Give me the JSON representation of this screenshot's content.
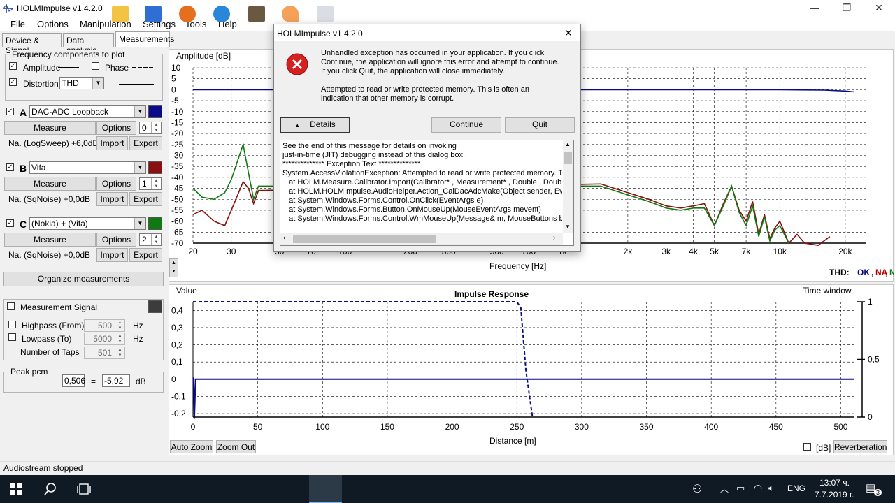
{
  "window": {
    "title": "HOLMImpulse  v1.4.2.0",
    "minimize": "—",
    "restore": "❐",
    "close": "✕"
  },
  "menu": [
    "File",
    "Options",
    "Manipulation",
    "Settings",
    "Tools",
    "Help"
  ],
  "tabs": [
    {
      "label": "Device & Signal",
      "active": false
    },
    {
      "label": "Data analysis",
      "active": false
    },
    {
      "label": "Measurements",
      "active": true
    }
  ],
  "freq_components": {
    "title": "Frequency components to plot",
    "amplitude": "Amplitude",
    "phase": "Phase",
    "distortion": "Distortion",
    "distortion_type": "THD"
  },
  "measurements": [
    {
      "letter": "A",
      "name": "DAC-ADC Loopback",
      "color": "#0a0a8a",
      "info": "Na. (LogSweep) +6,0dB",
      "count": "0"
    },
    {
      "letter": "B",
      "name": "Vifa",
      "color": "#8b0f0f",
      "info": "Na. (SqNoise) +0,0dB",
      "count": "1"
    },
    {
      "letter": "C",
      "name": "(Nokia) + (Vifa)",
      "color": "#0f7a0f",
      "info": "Na. (SqNoise) +0,0dB",
      "count": "2"
    }
  ],
  "buttons": {
    "measure": "Measure",
    "options": "Options",
    "import": "Import",
    "export": "Export",
    "organize": "Organize measurements",
    "auto_zoom": "Auto Zoom",
    "zoom_out": "Zoom Out",
    "reverberation": "Reverberation"
  },
  "measurement_signal": {
    "label": "Measurement Signal",
    "highpass": "Highpass (From)",
    "highpass_value": "500",
    "hz1": "Hz",
    "lowpass": "Lowpass (To)",
    "lowpass_value": "5000",
    "hz2": "Hz",
    "taps": "Number of Taps",
    "taps_value": "501"
  },
  "peak": {
    "title": "Peak pcm",
    "value": "0,506",
    "eq": "=",
    "db_value": "-5,92",
    "unit": "dB"
  },
  "amplitude_chart": {
    "ylabel": "Amplitude [dB]",
    "xlabel": "Frequency [Hz]",
    "y_ticks": [
      "10",
      "5",
      "0",
      "-5",
      "-10",
      "-15",
      "-20",
      "-25",
      "-30",
      "-35",
      "-40",
      "-45",
      "-50",
      "-55",
      "-60",
      "-65",
      "-70"
    ],
    "x_ticks": [
      "20",
      "30",
      "50",
      "70",
      "100",
      "200",
      "300",
      "500",
      "700",
      "1k",
      "2k",
      "3k",
      "4k",
      "5k",
      "7k",
      "10k",
      "20k"
    ],
    "thd_label": "THD:",
    "thd_values": [
      {
        "text": "OK",
        "color": "#0a0a8a"
      },
      {
        "text": "NA",
        "color": "#c00000"
      },
      {
        "text": "NA",
        "color": "#0f7a0f"
      }
    ]
  },
  "impulse_chart": {
    "title": "Impulse Response",
    "ylabel": "Value",
    "right_label": "Time window",
    "xlabel": "Distance [m]",
    "y_ticks": [
      "0,4",
      "0,3",
      "0,2",
      "0,1",
      "0",
      "-0,1",
      "-0,2"
    ],
    "x_ticks": [
      "0",
      "50",
      "100",
      "150",
      "200",
      "250",
      "300",
      "350",
      "400",
      "450",
      "500"
    ],
    "right_ticks": [
      "1",
      "0,5",
      "0"
    ],
    "db_check": "[dB]"
  },
  "chart_data": [
    {
      "type": "line",
      "ylabel": "Amplitude [dB]",
      "xlabel": "Frequency [Hz]",
      "xscale": "log",
      "xlim": [
        20,
        25000
      ],
      "ylim": [
        -70,
        10
      ],
      "grid": true,
      "series": [
        {
          "name": "DAC-ADC Loopback",
          "color": "#0a0a8a",
          "x": [
            20,
            100,
            1000,
            10000,
            16000,
            20000,
            22000
          ],
          "y": [
            0,
            0,
            0,
            0,
            -0.2,
            -0.6,
            -1
          ]
        },
        {
          "name": "Vifa",
          "color": "#8b0f0f",
          "x": [
            20,
            22,
            25,
            28,
            30,
            34,
            36,
            38,
            40,
            1500,
            2000,
            2500,
            3000,
            3500,
            4000,
            4500,
            5000,
            5500,
            6000,
            6500,
            7000,
            7500,
            8000,
            8500,
            9000,
            9500,
            10000,
            11000,
            12000,
            13000,
            15000,
            17000
          ],
          "y": [
            -57,
            -55,
            -60,
            -62,
            -55,
            -42,
            -45,
            -52,
            -46,
            -43,
            -47,
            -50,
            -53,
            -54,
            -53,
            -52,
            -62,
            -52,
            -44,
            -55,
            -60,
            -51,
            -66,
            -57,
            -68,
            -63,
            -60,
            -70,
            -66,
            -70,
            -71,
            -67
          ]
        },
        {
          "name": "(Nokia) + (Vifa)",
          "color": "#0f7a0f",
          "x": [
            20,
            22,
            25,
            28,
            30,
            34,
            36,
            38,
            40,
            1500,
            2000,
            2500,
            3000,
            3500,
            4000,
            4500,
            5000,
            5500,
            6000,
            6500,
            7000,
            7500,
            8000,
            8500,
            9000,
            9500,
            10000,
            11000
          ],
          "y": [
            -45,
            -49,
            -50,
            -47,
            -41,
            -25,
            -38,
            -50,
            -44,
            -44,
            -48,
            -51,
            -54,
            -55,
            -54,
            -54,
            -62,
            -53,
            -44,
            -56,
            -62,
            -53,
            -67,
            -58,
            -69,
            -64,
            -62,
            -70
          ]
        }
      ]
    },
    {
      "type": "line",
      "title": "Impulse Response",
      "ylabel": "Value",
      "xlabel": "Distance [m]",
      "xlim": [
        0,
        510
      ],
      "ylim": [
        -0.22,
        0.45
      ],
      "y2label": "Time window",
      "y2lim": [
        0,
        1
      ],
      "grid": true,
      "series": [
        {
          "name": "impulse",
          "color": "#0a0a8a",
          "x": [
            0,
            0.5,
            1,
            2,
            510
          ],
          "y": [
            0,
            0.01,
            -0.23,
            0,
            0
          ]
        },
        {
          "name": "window",
          "color": "#0a0a8a",
          "dashed": true,
          "axis": "y2",
          "x": [
            0,
            250,
            253,
            257,
            262
          ],
          "y": [
            1,
            1,
            0.95,
            0.4,
            0
          ]
        }
      ]
    }
  ],
  "status": "Audiostream stopped",
  "taskbar": {
    "lang": "ENG",
    "time": "13:07 ч.",
    "date": "7.7.2019 г.",
    "notif": "3"
  },
  "dialog": {
    "title": "HOLMImpulse  v1.4.2.0",
    "message1": "Unhandled exception has occurred in your application. If you click Continue, the application will ignore this error and attempt to continue. If you click Quit, the application will close immediately.",
    "message2": "Attempted to read or write protected memory. This is often an indication that other memory is corrupt.",
    "details": "Details",
    "continue": "Continue",
    "quit": "Quit",
    "details_text": [
      "See the end of this message for details on invoking",
      "just-in-time (JIT) debugging instead of this dialog box.",
      "",
      "************** Exception Text **************",
      "System.AccessViolationException: Attempted to read or write protected memory. This",
      "   at HOLM.Measure.Calibrator.Import(Calibrator* , Measurement* , Double , Double )",
      "   at HOLM.HOLMImpulse.AudioHelper.Action_CalDacAdcMake(Object sender, Ever",
      "   at System.Windows.Forms.Control.OnClick(EventArgs e)",
      "   at System.Windows.Forms.Button.OnMouseUp(MouseEventArgs mevent)",
      "   at System.Windows.Forms.Control.WmMouseUp(Message& m, MouseButtons buttc"
    ]
  }
}
